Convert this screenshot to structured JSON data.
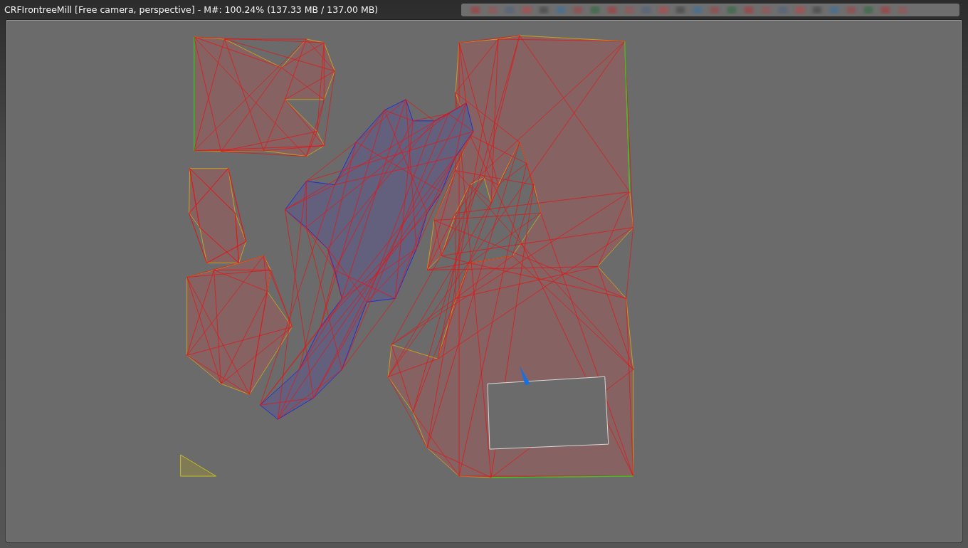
{
  "window": {
    "title": "CRFIrontreeMill [Free camera, perspective] - M#: 100.24% (137.33 MB / 137.00 MB)"
  }
}
